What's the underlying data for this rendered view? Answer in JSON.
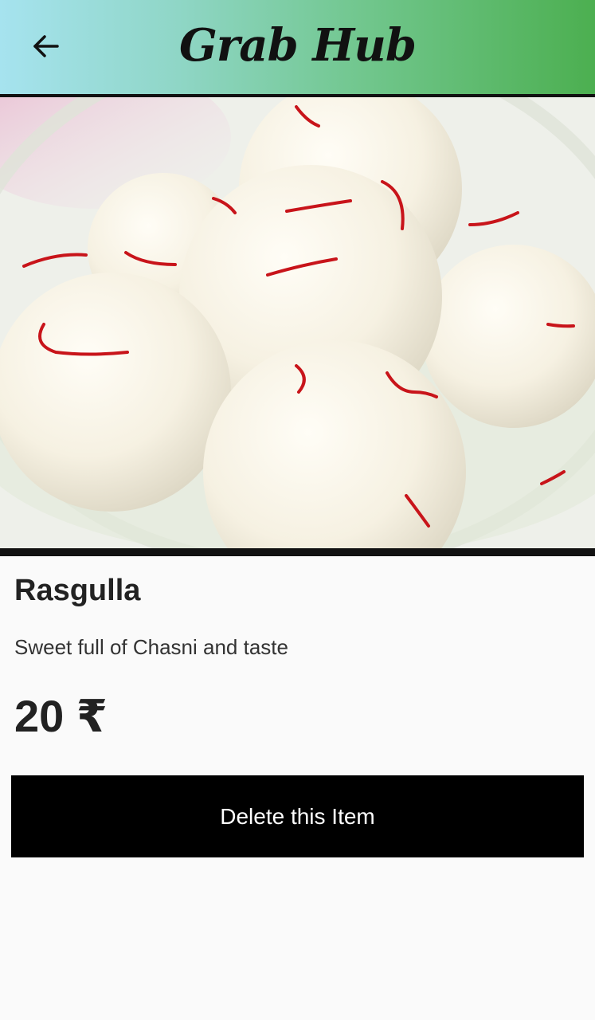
{
  "header": {
    "title": "Grab Hub",
    "back_icon": "arrow-left-icon"
  },
  "item": {
    "name": "Rasgulla",
    "description": "Sweet full of Chasni and taste",
    "price": "20 ₹"
  },
  "actions": {
    "delete_label": "Delete this Item"
  },
  "colors": {
    "header_gradient_start": "#a6e3ef",
    "header_gradient_end": "#4caf50",
    "button_bg": "#000000",
    "button_text": "#ffffff"
  }
}
